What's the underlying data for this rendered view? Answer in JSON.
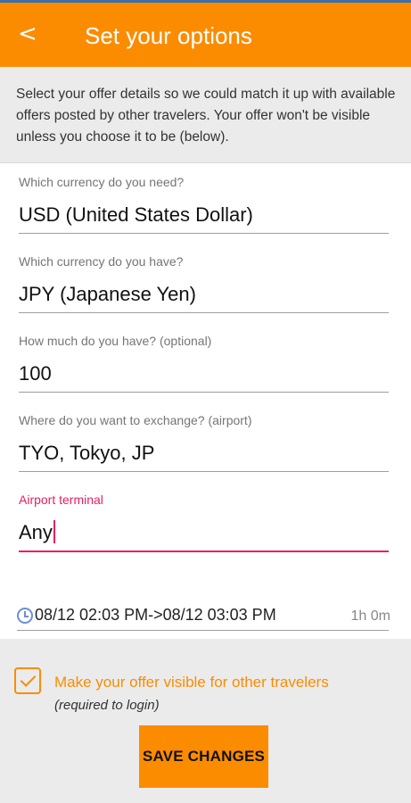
{
  "appbar": {
    "back_symbol": "<",
    "title": "Set your options"
  },
  "intro_text": "Select your offer details so we could match it up with available offers posted by other travelers. Your offer won't be visible unless you choose it to be (below).",
  "form": {
    "currency_need": {
      "label": "Which currency do you need?",
      "value": "USD (United States Dollar)"
    },
    "currency_have": {
      "label": "Which currency do you have?",
      "value": "JPY (Japanese Yen)"
    },
    "amount": {
      "label": "How much do you have? (optional)",
      "value": "100"
    },
    "location": {
      "label": "Where do you want to exchange? (airport)",
      "value": "TYO, Tokyo, JP"
    },
    "terminal": {
      "label": "Airport terminal",
      "value": "Any"
    },
    "time": {
      "range": "08/12 02:03 PM->08/12 03:03 PM",
      "duration": "1h 0m",
      "icon": "clock-icon"
    }
  },
  "visibility": {
    "checked": true,
    "label": "Make your offer visible for other travelers",
    "note": "(required to login)"
  },
  "save_label": "SAVE CHANGES",
  "colors": {
    "accent": "#fb8c00",
    "focus": "#e91e63",
    "clock": "#6b8fd6",
    "background": "#ebebeb"
  }
}
